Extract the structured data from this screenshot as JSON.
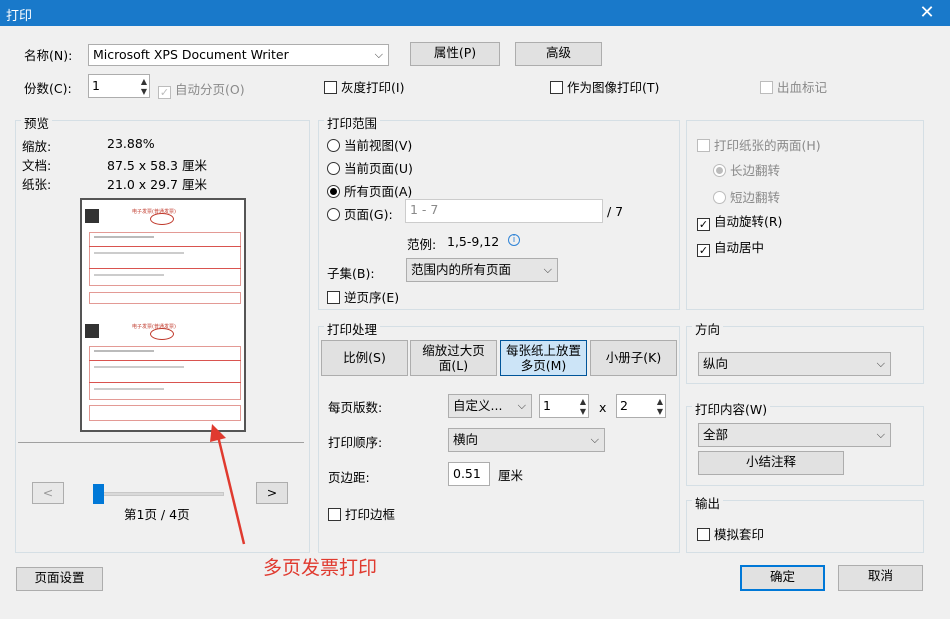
{
  "window": {
    "title": "打印"
  },
  "printer": {
    "name_label": "名称(N):",
    "name_value": "Microsoft XPS Document Writer",
    "properties_button": "属性(P)",
    "advanced_button": "高级"
  },
  "copies": {
    "label": "份数(C):",
    "value": "1",
    "collate": "自动分页(O)",
    "grayscale": "灰度打印(I)",
    "print_as_image": "作为图像打印(T)",
    "bleed_marks": "出血标记"
  },
  "preview": {
    "group_label": "预览",
    "zoom_label": "缩放:",
    "zoom_value": "23.88%",
    "doc_label": "文档:",
    "doc_value": "87.5 x 58.3 厘米",
    "paper_label": "纸张:",
    "paper_value": "21.0 x 29.7 厘米",
    "prev_button": "<",
    "next_button": ">",
    "page_indicator": "第1页 / 4页",
    "slider_position": 0,
    "invoice_title": "电子发票(普通发票)"
  },
  "print_range": {
    "group_label": "打印范围",
    "current_view": "当前视图(V)",
    "current_page": "当前页面(U)",
    "all_pages": "所有页面(A)",
    "pages": "页面(G):",
    "pages_value": "1 - 7",
    "pages_total": "/ 7",
    "example_label": "范例:",
    "example_value": "1,5-9,12",
    "subset_label": "子集(B):",
    "subset_value": "范围内的所有页面",
    "reverse_order": "逆页序(E)"
  },
  "duplex": {
    "print_both_sides": "打印纸张的两面(H)",
    "long_edge": "长边翻转",
    "short_edge": "短边翻转",
    "auto_rotate": "自动旋转(R)",
    "auto_center": "自动居中"
  },
  "handling": {
    "group_label": "打印处理",
    "tabs": [
      "比例(S)",
      "缩放过大页面(L)",
      "每张纸上放置多页(M)",
      "小册子(K)"
    ],
    "pages_per_sheet_label": "每页版数:",
    "pages_per_sheet_value": "自定义...",
    "cols_value": "1",
    "times": "x",
    "rows_value": "2",
    "order_label": "打印顺序:",
    "order_value": "横向",
    "margin_label": "页边距:",
    "margin_value": "0.51",
    "margin_unit": "厘米",
    "print_border": "打印边框"
  },
  "orientation": {
    "group_label": "方向",
    "value": "纵向"
  },
  "content": {
    "group_label": "打印内容(W)",
    "value": "全部",
    "summary_button": "小结注释"
  },
  "output": {
    "group_label": "输出",
    "simulate_overprint": "模拟套印"
  },
  "footer": {
    "page_setup_button": "页面设置",
    "ok_button": "确定",
    "cancel_button": "取消"
  },
  "annotation": {
    "text": "多页发票打印",
    "color": "#e03a2f"
  }
}
